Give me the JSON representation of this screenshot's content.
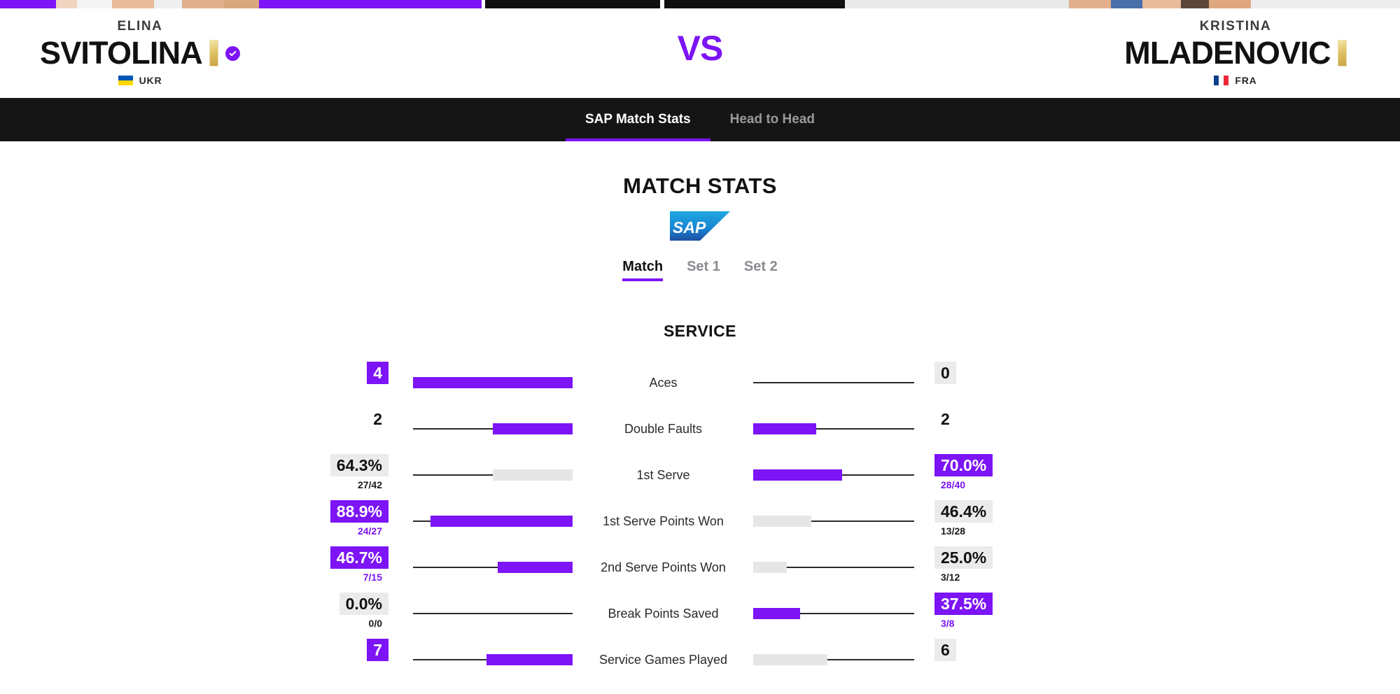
{
  "theme": {
    "accent": "#7C14F5",
    "nav_bg": "#151515",
    "bar_track": "#2b2b2b",
    "bar_lose": "#e6e6e6",
    "badge_lose_bg": "#ebebeb",
    "page_bg": "#ffffff"
  },
  "header": {
    "vs_label": "VS",
    "player_left": {
      "first_name": "ELINA",
      "last_name": "SVITOLINA",
      "country_code": "UKR",
      "flag": "ukraine-flag",
      "seed_marker": "gold-seed-bar",
      "verified": "verified-check-icon"
    },
    "player_right": {
      "first_name": "KRISTINA",
      "last_name": "MLADENOVIC",
      "country_code": "FRA",
      "flag": "france-flag",
      "seed_marker": "gold-seed-bar",
      "verified": null
    }
  },
  "nav": {
    "tabs": [
      {
        "label": "SAP Match Stats",
        "active": true
      },
      {
        "label": "Head to Head",
        "active": false
      }
    ]
  },
  "main": {
    "title": "MATCH STATS",
    "sponsor_logo": "sap-logo",
    "sponsor_name": "SAP",
    "set_tabs": [
      {
        "label": "Match",
        "active": true
      },
      {
        "label": "Set 1",
        "active": false
      },
      {
        "label": "Set 2",
        "active": false
      }
    ],
    "groups": [
      {
        "title": "SERVICE",
        "rows": [
          {
            "label": "Aces",
            "left": {
              "value": "4",
              "sub": null,
              "state": "win",
              "bar_pct": 100
            },
            "right": {
              "value": "0",
              "sub": null,
              "state": "lose",
              "bar_pct": 0
            }
          },
          {
            "label": "Double Faults",
            "left": {
              "value": "2",
              "sub": null,
              "state": "tie",
              "bar_pct": 50
            },
            "right": {
              "value": "2",
              "sub": null,
              "state": "tie",
              "bar_pct": 39
            }
          },
          {
            "label": "1st Serve",
            "left": {
              "value": "64.3%",
              "sub": "27/42",
              "state": "lose",
              "bar_pct": 50
            },
            "right": {
              "value": "70.0%",
              "sub": "28/40",
              "state": "win",
              "bar_pct": 55
            }
          },
          {
            "label": "1st Serve Points Won",
            "left": {
              "value": "88.9%",
              "sub": "24/27",
              "state": "win",
              "bar_pct": 89
            },
            "right": {
              "value": "46.4%",
              "sub": "13/28",
              "state": "lose",
              "bar_pct": 36
            }
          },
          {
            "label": "2nd Serve Points Won",
            "left": {
              "value": "46.7%",
              "sub": "7/15",
              "state": "win",
              "bar_pct": 47
            },
            "right": {
              "value": "25.0%",
              "sub": "3/12",
              "state": "lose",
              "bar_pct": 21
            }
          },
          {
            "label": "Break Points Saved",
            "left": {
              "value": "0.0%",
              "sub": "0/0",
              "state": "lose",
              "bar_pct": 0
            },
            "right": {
              "value": "37.5%",
              "sub": "3/8",
              "state": "win",
              "bar_pct": 29
            }
          },
          {
            "label": "Service Games Played",
            "left": {
              "value": "7",
              "sub": null,
              "state": "win",
              "bar_pct": 54
            },
            "right": {
              "value": "6",
              "sub": null,
              "state": "lose",
              "bar_pct": 46
            }
          }
        ]
      }
    ]
  }
}
